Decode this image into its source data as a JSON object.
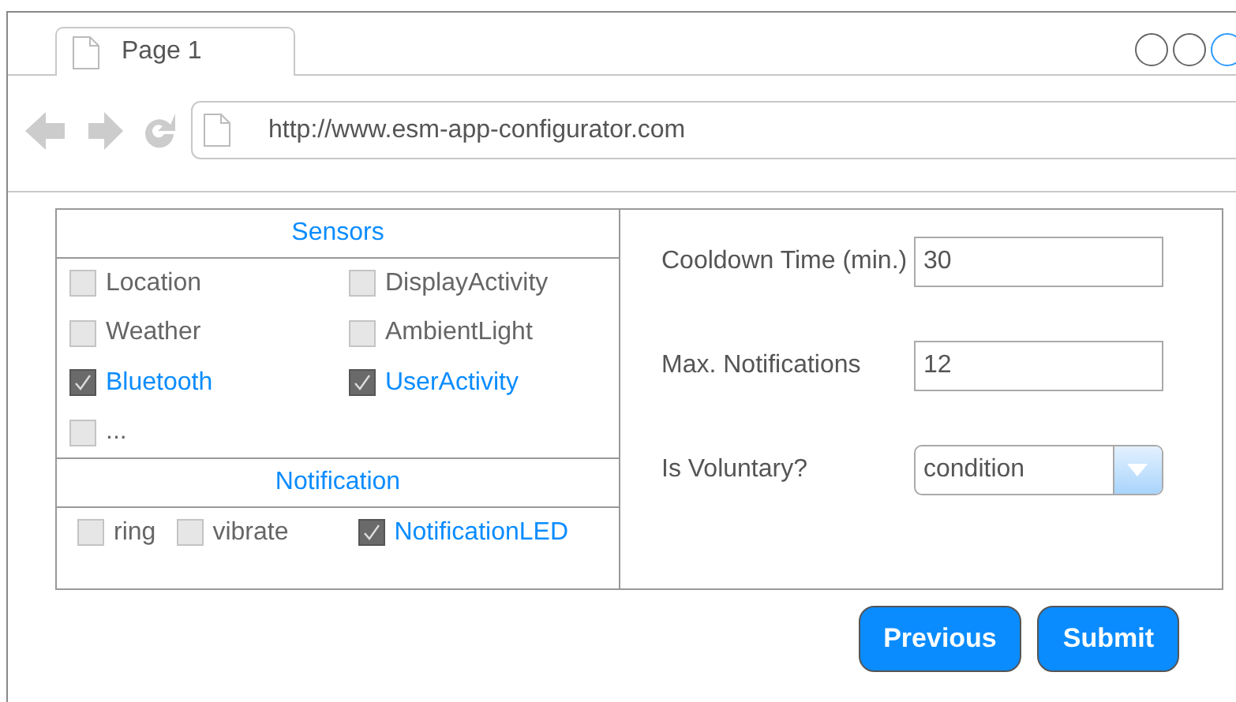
{
  "browser": {
    "tab": {
      "title": "Page 1"
    },
    "address": "http://www.esm-app-configurator.com"
  },
  "sensors": {
    "title": "Sensors",
    "items": [
      {
        "label": "Location",
        "checked": false
      },
      {
        "label": "DisplayActivity",
        "checked": false
      },
      {
        "label": "Weather",
        "checked": false
      },
      {
        "label": "AmbientLight",
        "checked": false
      },
      {
        "label": "Bluetooth",
        "checked": true
      },
      {
        "label": "UserActivity",
        "checked": true
      },
      {
        "label": "...",
        "checked": false
      }
    ]
  },
  "notification": {
    "title": "Notification",
    "items": [
      {
        "label": "ring",
        "checked": false
      },
      {
        "label": "vibrate",
        "checked": false
      },
      {
        "label": "NotificationLED",
        "checked": true
      }
    ]
  },
  "settings": [
    {
      "label": "Cooldown Time (min.)",
      "kind": "text",
      "value": "30"
    },
    {
      "label": "Max. Notifications",
      "kind": "text",
      "value": "12"
    },
    {
      "label": "Is Voluntary?",
      "kind": "select",
      "value": "condition"
    }
  ],
  "buttons": [
    "Previous",
    "Submit"
  ]
}
